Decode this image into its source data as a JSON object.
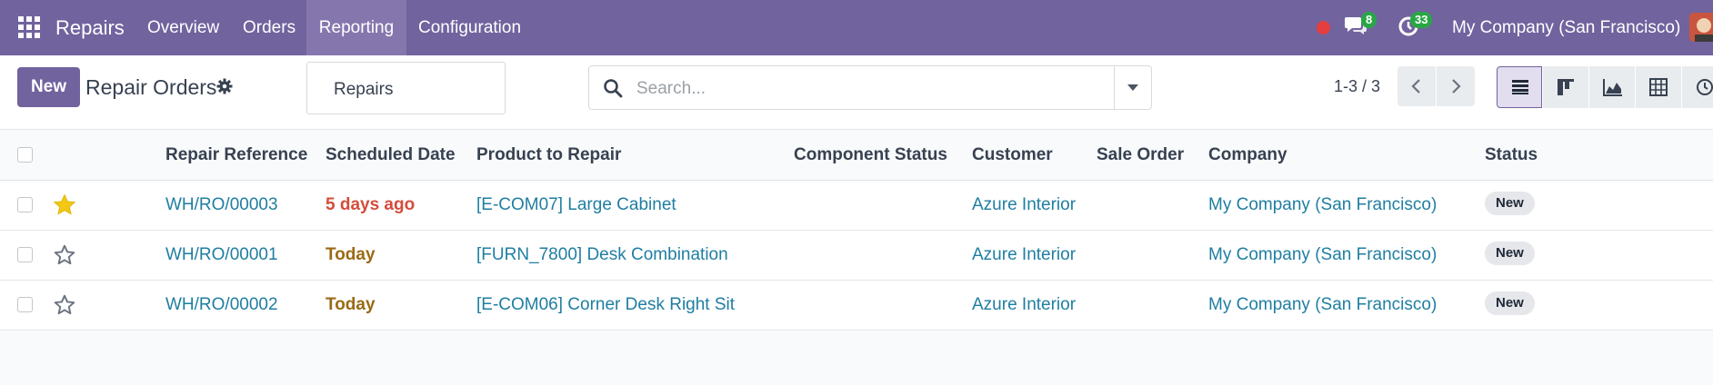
{
  "navbar": {
    "brand": "Repairs",
    "menu": [
      "Overview",
      "Orders",
      "Reporting",
      "Configuration"
    ],
    "active_menu": "Reporting",
    "messages_count": "8",
    "activities_count": "33",
    "company": "My Company (San Francisco)",
    "colors": {
      "bar": "#71639e",
      "active": "#8577ae",
      "badge": "#28a745",
      "recording": "#e53e3e"
    }
  },
  "control_panel": {
    "new_label": "New",
    "title": "Repair Orders",
    "breadcrumb": "Repairs",
    "search_placeholder": "Search...",
    "pager": "1-3 / 3",
    "views": [
      "list-icon",
      "kanban-icon",
      "graph-icon",
      "pivot-icon",
      "activity-icon"
    ],
    "active_view": "list"
  },
  "table": {
    "columns": [
      "Repair Reference",
      "Scheduled Date",
      "Product to Repair",
      "Component Status",
      "Customer",
      "Sale Order",
      "Company",
      "Status"
    ],
    "rows": [
      {
        "favorite": true,
        "reference": "WH/RO/00003",
        "scheduled": "5 days ago",
        "scheduled_state": "late",
        "product": "[E-COM07] Large Cabinet",
        "component_status": "",
        "customer": "Azure Interior",
        "sale_order": "",
        "company": "My Company (San Francisco)",
        "status": "New"
      },
      {
        "favorite": false,
        "reference": "WH/RO/00001",
        "scheduled": "Today",
        "scheduled_state": "today",
        "product": "[FURN_7800] Desk Combination",
        "component_status": "",
        "customer": "Azure Interior",
        "sale_order": "",
        "company": "My Company (San Francisco)",
        "status": "New"
      },
      {
        "favorite": false,
        "reference": "WH/RO/00002",
        "scheduled": "Today",
        "scheduled_state": "today",
        "product": "[E-COM06] Corner Desk Right Sit",
        "component_status": "",
        "customer": "Azure Interior",
        "sale_order": "",
        "company": "My Company (San Francisco)",
        "status": "New"
      }
    ],
    "colors": {
      "link": "#1f7ea1",
      "late": "#d44c3b",
      "today": "#9a6a14",
      "star": "#f3c814"
    }
  }
}
